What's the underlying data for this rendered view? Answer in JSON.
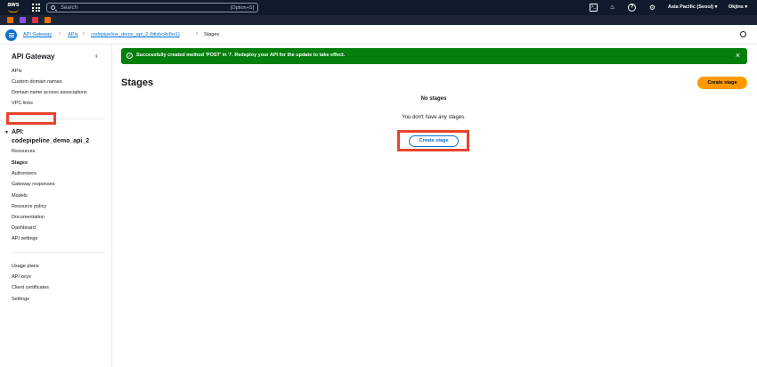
{
  "topbar": {
    "logo_text": "aws",
    "search_placeholder": "Search",
    "search_shortcut": "[Option+S]",
    "region": "Asia Pacific (Seoul)",
    "account": "Okjins",
    "icons": [
      "cloudshell-icon",
      "bell-icon",
      "help-icon",
      "gear-icon"
    ]
  },
  "favorites": {
    "colors": [
      "#ed7100",
      "#8c4fff",
      "#dd344c",
      "#ed7100"
    ]
  },
  "breadcrumb": {
    "items": [
      "API Gateway",
      "APIs",
      "codepipeline_demo_api_2 (btixbc4x8w1)",
      "Stages"
    ]
  },
  "sidebar": {
    "title": "API Gateway",
    "top_items": [
      "APIs",
      "Custom domain names",
      "Domain name access associations",
      "VPC links"
    ],
    "api_label": "API:",
    "api_name": "codepipeline_demo_api_2",
    "api_items": [
      "Resources",
      "Stages",
      "Authorizers",
      "Gateway responses",
      "Models",
      "Resource policy",
      "Documentation",
      "Dashboard",
      "API settings"
    ],
    "bottom_items": [
      "Usage plans",
      "API keys",
      "Client certificates",
      "Settings"
    ]
  },
  "flash": {
    "message": "Successfully created method 'POST' in '/'. Redeploy your API for the update to take effect.",
    "color": "#037f0c"
  },
  "main": {
    "title": "Stages",
    "create_button": "Create stage",
    "empty_title": "No stages",
    "empty_text": "You don't have any stages.",
    "empty_button": "Create stage",
    "accent": "#ff9900",
    "link_color": "#0972d3",
    "highlight_color": "#e8432d"
  }
}
